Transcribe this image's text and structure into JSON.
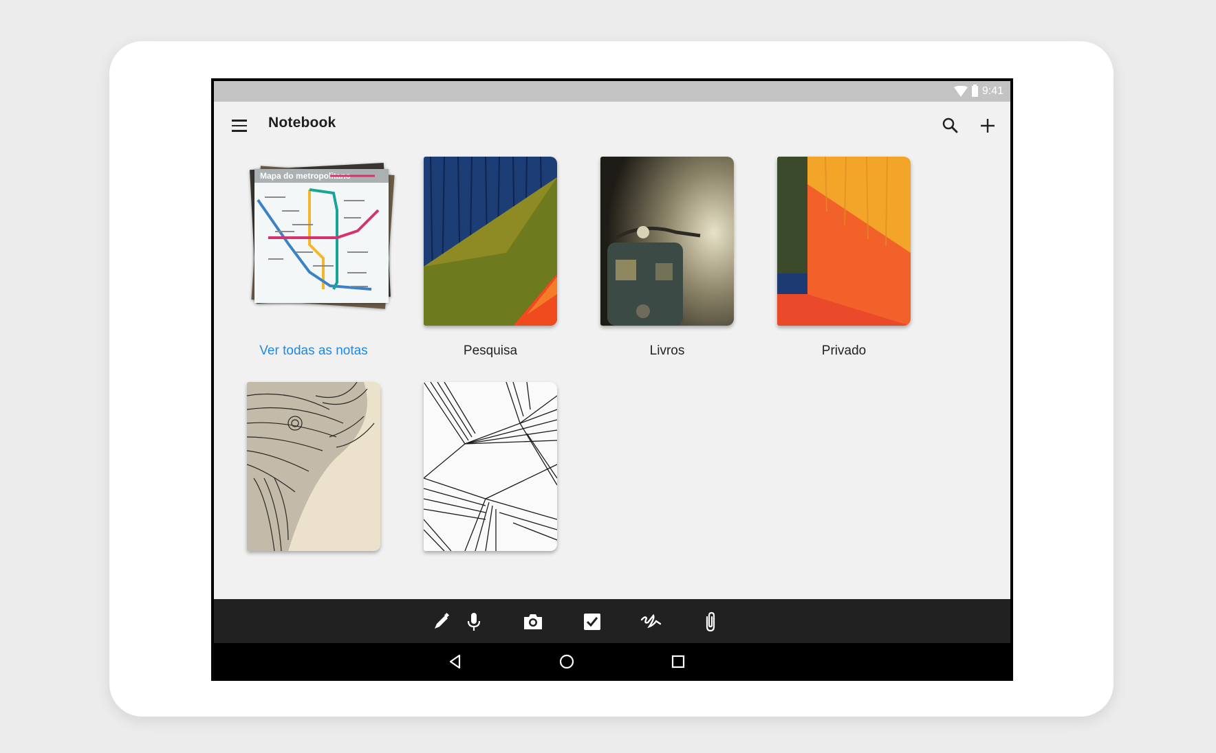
{
  "status_bar": {
    "time": "9:41"
  },
  "app_bar": {
    "title": "Notebook"
  },
  "notebooks": [
    {
      "label": "Ver todas as notas",
      "map_title": "Mapa do metropolitano"
    },
    {
      "label": "Pesquisa"
    },
    {
      "label": "Livros"
    },
    {
      "label": "Privado"
    },
    {
      "label": ""
    },
    {
      "label": ""
    }
  ],
  "colors": {
    "link": "#1e88e5",
    "action_bar": "#212121",
    "status_bar": "#c3c3c3",
    "background": "#f1f1f1"
  },
  "icons": [
    "menu-icon",
    "search-icon",
    "plus-icon",
    "pencil-icon",
    "microphone-icon",
    "camera-icon",
    "checkbox-icon",
    "handwriting-icon",
    "paperclip-icon",
    "back-icon",
    "home-icon",
    "recents-icon"
  ]
}
